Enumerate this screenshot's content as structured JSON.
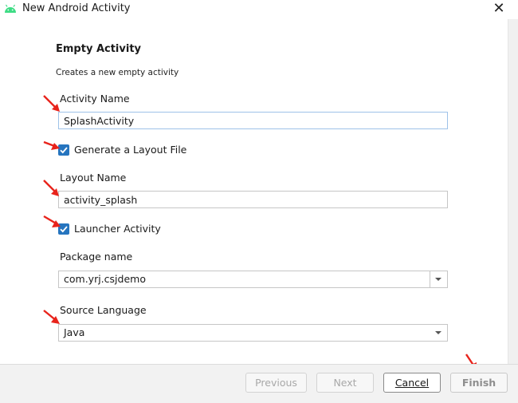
{
  "window": {
    "title": "New Android Activity",
    "close_icon": "close-icon",
    "app_icon": "android-icon",
    "android_color": "#3ddc84"
  },
  "template": {
    "heading": "Empty Activity",
    "description": "Creates a new empty activity"
  },
  "form": {
    "activity_name": {
      "label": "Activity Name",
      "value": "SplashActivity"
    },
    "generate_layout": {
      "label": "Generate a Layout File",
      "checked": true
    },
    "layout_name": {
      "label": "Layout Name",
      "value": "activity_splash"
    },
    "launcher_activity": {
      "label": "Launcher Activity",
      "checked": true
    },
    "package_name": {
      "label": "Package name",
      "value": "com.yrj.csjdemo"
    },
    "source_language": {
      "label": "Source Language",
      "value": "Java"
    }
  },
  "buttons": {
    "previous": "Previous",
    "next": "Next",
    "cancel": "Cancel",
    "finish": "Finish"
  },
  "colors": {
    "checkbox": "#2675bf",
    "annotation_arrow": "#e8231b"
  }
}
